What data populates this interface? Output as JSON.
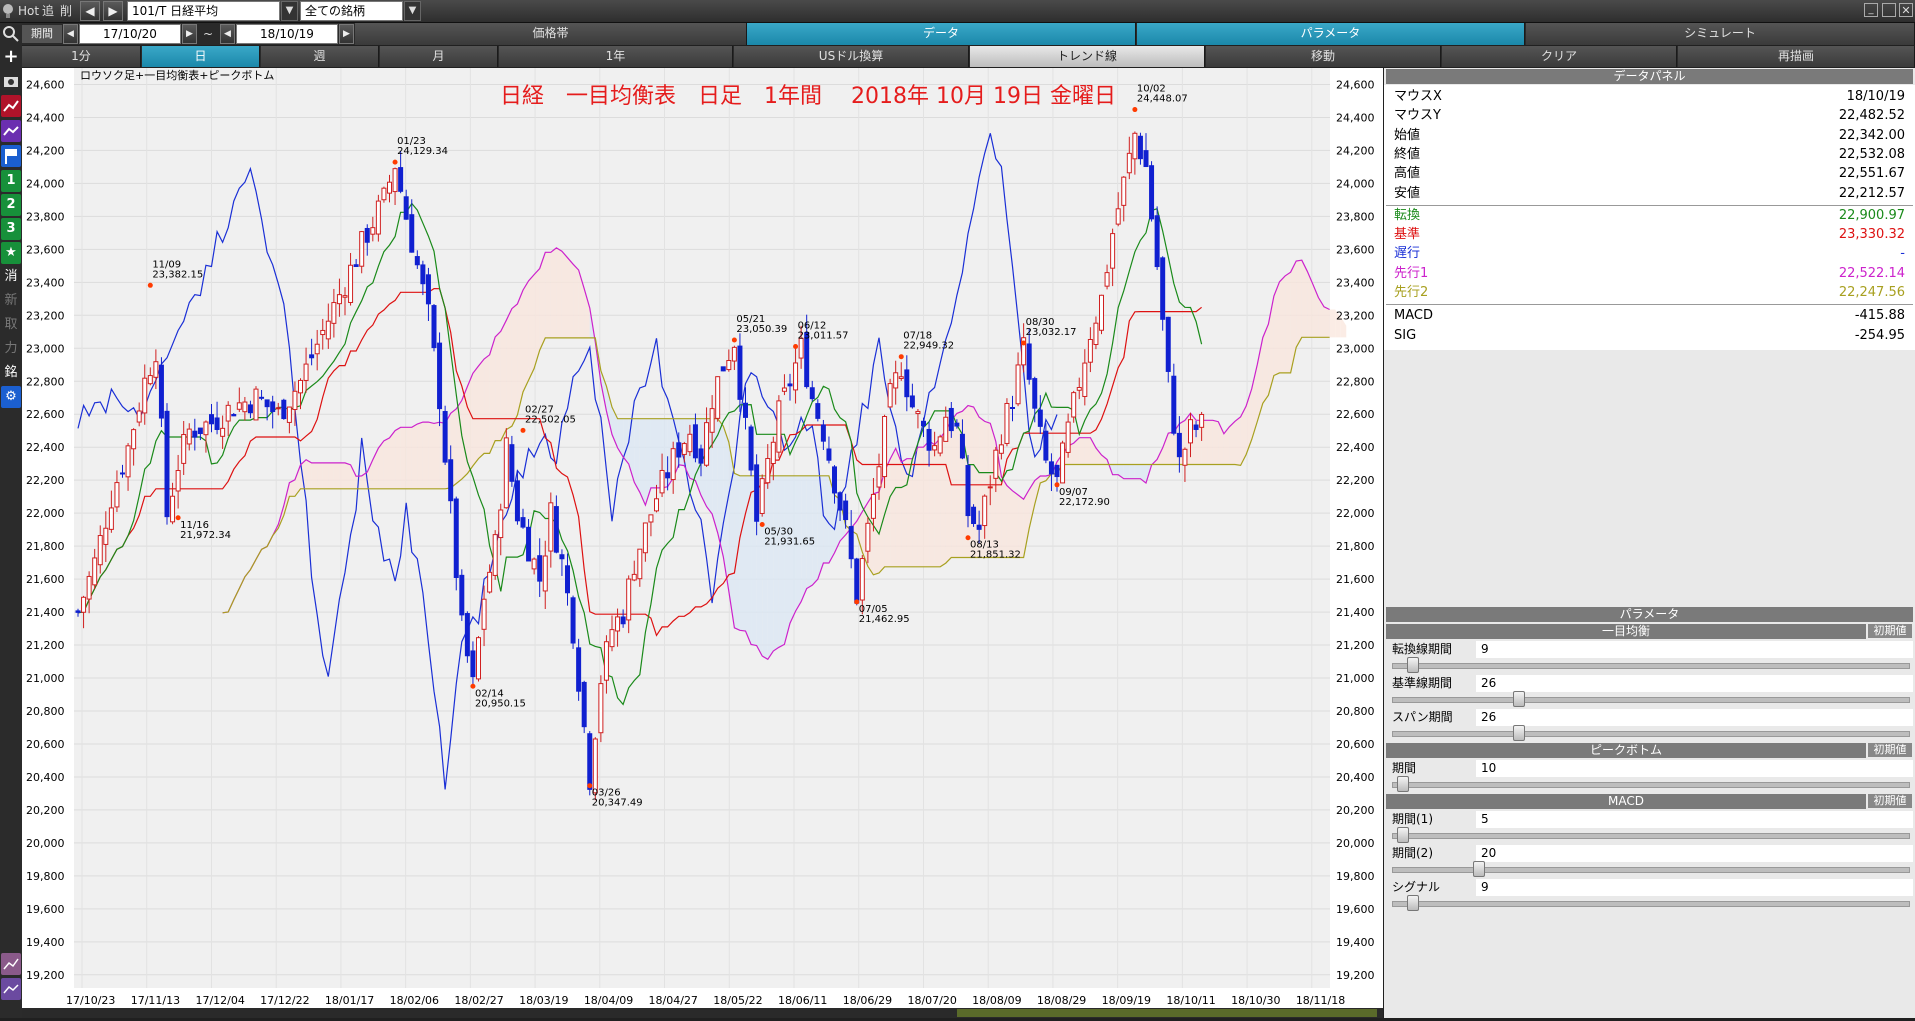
{
  "toolbar": {
    "hot": "Hot",
    "add": "追",
    "del": "削",
    "symbol": "101/T 日経平均",
    "universe": "全ての銘柄",
    "period_label": "期間",
    "date_from": "17/10/20",
    "dash": "~",
    "date_to": "18/10/19",
    "tabs_top": [
      "価格帯",
      "データ",
      "パラメータ",
      "シミュレート"
    ],
    "tabs_row": [
      "1分",
      "日",
      "週",
      "月",
      "1年",
      "USドル換算",
      "トレンド線",
      "移動",
      "クリア",
      "再描画"
    ]
  },
  "leftbar": {
    "items": [
      "1",
      "2",
      "3",
      "消",
      "新",
      "取",
      "力",
      "銘"
    ]
  },
  "chart": {
    "legend": "ロウソク足+一目均衡表+ピークボトム",
    "title": "日経　一目均衡表　日足　1年間　 2018年 10月 19日 金曜日",
    "y_ticks": [
      "24,600",
      "24,400",
      "24,200",
      "24,000",
      "23,800",
      "23,600",
      "23,400",
      "23,200",
      "23,000",
      "22,800",
      "22,600",
      "22,400",
      "22,200",
      "22,000",
      "21,800",
      "21,600",
      "21,400",
      "21,200",
      "21,000",
      "20,800",
      "20,600",
      "20,400",
      "20,200",
      "20,000",
      "19,800",
      "19,600",
      "19,400",
      "19,200"
    ],
    "x_ticks": [
      "17/10/23",
      "17/11/13",
      "17/12/04",
      "17/12/22",
      "18/01/17",
      "18/02/06",
      "18/02/27",
      "18/03/19",
      "18/04/09",
      "18/04/27",
      "18/05/22",
      "18/06/11",
      "18/06/29",
      "18/07/20",
      "18/08/09",
      "18/08/29",
      "18/09/19",
      "18/10/11",
      "18/10/30",
      "18/11/18"
    ],
    "peaks": [
      {
        "date": "11/09",
        "value": "23,382.15",
        "p": 23382
      },
      {
        "date": "11/16",
        "value": "21,972.34",
        "p": 21972
      },
      {
        "date": "01/23",
        "value": "24,129.34",
        "p": 24129
      },
      {
        "date": "02/14",
        "value": "20,950.15",
        "p": 20950
      },
      {
        "date": "02/27",
        "value": "22,502.05",
        "p": 22502
      },
      {
        "date": "03/26",
        "value": "20,347.49",
        "p": 20347
      },
      {
        "date": "05/21",
        "value": "23,050.39",
        "p": 23050
      },
      {
        "date": "05/30",
        "value": "21,931.65",
        "p": 21931
      },
      {
        "date": "06/12",
        "value": "23,011.57",
        "p": 23011
      },
      {
        "date": "07/05",
        "value": "21,462.95",
        "p": 21462
      },
      {
        "date": "07/18",
        "value": "22,949.32",
        "p": 22949
      },
      {
        "date": "08/13",
        "value": "21,851.32",
        "p": 21851
      },
      {
        "date": "08/30",
        "value": "23,032.17",
        "p": 23032
      },
      {
        "date": "09/07",
        "value": "22,172.90",
        "p": 22172
      },
      {
        "date": "10/02",
        "value": "24,448.07",
        "p": 24448
      }
    ]
  },
  "chart_data": {
    "type": "candlestick+ichimoku",
    "title": "日経　一目均衡表　日足　1年間　 2018年 10月 19日 金曜日",
    "ylim": [
      19200,
      24600
    ],
    "series": [
      {
        "name": "転換",
        "color": "#1a8a1a"
      },
      {
        "name": "基準",
        "color": "#dd1111"
      },
      {
        "name": "遅行",
        "color": "#1a2fd6"
      },
      {
        "name": "先行1",
        "color": "#cc22cc"
      },
      {
        "name": "先行2",
        "color": "#a8a020"
      }
    ],
    "close_path": [
      [
        0,
        21400
      ],
      [
        3,
        21700
      ],
      [
        6,
        22100
      ],
      [
        9,
        22400
      ],
      [
        12,
        22800
      ],
      [
        14,
        23000
      ],
      [
        16,
        21990
      ],
      [
        18,
        22300
      ],
      [
        20,
        22500
      ],
      [
        24,
        22550
      ],
      [
        28,
        22650
      ],
      [
        32,
        22700
      ],
      [
        36,
        22600
      ],
      [
        40,
        22800
      ],
      [
        44,
        23100
      ],
      [
        48,
        23400
      ],
      [
        52,
        23700
      ],
      [
        55,
        23900
      ],
      [
        57,
        24120
      ],
      [
        59,
        23800
      ],
      [
        61,
        23500
      ],
      [
        63,
        23200
      ],
      [
        65,
        22700
      ],
      [
        67,
        22000
      ],
      [
        69,
        21300
      ],
      [
        71,
        20950
      ],
      [
        73,
        21500
      ],
      [
        75,
        21800
      ],
      [
        77,
        22400
      ],
      [
        79,
        22000
      ],
      [
        81,
        21800
      ],
      [
        83,
        21600
      ],
      [
        85,
        22000
      ],
      [
        87,
        21700
      ],
      [
        89,
        21300
      ],
      [
        91,
        20700
      ],
      [
        92,
        20400
      ],
      [
        94,
        21000
      ],
      [
        96,
        21300
      ],
      [
        98,
        21400
      ],
      [
        100,
        21700
      ],
      [
        102,
        21900
      ],
      [
        104,
        22100
      ],
      [
        106,
        22250
      ],
      [
        108,
        22400
      ],
      [
        110,
        22500
      ],
      [
        112,
        22350
      ],
      [
        114,
        22700
      ],
      [
        116,
        22900
      ],
      [
        118,
        23050
      ],
      [
        120,
        22500
      ],
      [
        122,
        21950
      ],
      [
        124,
        22300
      ],
      [
        126,
        22600
      ],
      [
        128,
        22800
      ],
      [
        130,
        23000
      ],
      [
        132,
        22700
      ],
      [
        134,
        22500
      ],
      [
        136,
        22200
      ],
      [
        138,
        21900
      ],
      [
        140,
        21500
      ],
      [
        142,
        21900
      ],
      [
        144,
        22300
      ],
      [
        146,
        22700
      ],
      [
        148,
        22900
      ],
      [
        150,
        22650
      ],
      [
        152,
        22500
      ],
      [
        154,
        22400
      ],
      [
        156,
        22600
      ],
      [
        158,
        22500
      ],
      [
        160,
        22000
      ],
      [
        162,
        21900
      ],
      [
        164,
        22200
      ],
      [
        166,
        22500
      ],
      [
        168,
        22700
      ],
      [
        170,
        23000
      ],
      [
        172,
        22600
      ],
      [
        174,
        22300
      ],
      [
        176,
        22180
      ],
      [
        178,
        22500
      ],
      [
        180,
        22800
      ],
      [
        182,
        23100
      ],
      [
        184,
        23300
      ],
      [
        186,
        23700
      ],
      [
        188,
        24000
      ],
      [
        190,
        24300
      ],
      [
        192,
        24100
      ],
      [
        193,
        23800
      ],
      [
        194,
        23500
      ],
      [
        196,
        22800
      ],
      [
        198,
        22300
      ],
      [
        200,
        22500
      ],
      [
        202,
        22530
      ]
    ]
  },
  "panel": {
    "data_header": "データパネル",
    "rows": [
      {
        "k": "マウスX",
        "v": "18/10/19",
        "c": "#000"
      },
      {
        "k": "マウスY",
        "v": "22,482.52",
        "c": "#000"
      },
      {
        "k": "始値",
        "v": "22,342.00",
        "c": "#000"
      },
      {
        "k": "終値",
        "v": "22,532.08",
        "c": "#000"
      },
      {
        "k": "高値",
        "v": "22,551.67",
        "c": "#000"
      },
      {
        "k": "安値",
        "v": "22,212.57",
        "c": "#000"
      },
      {
        "k": "転換",
        "v": "22,900.97",
        "c": "#1a8a1a"
      },
      {
        "k": "基準",
        "v": "23,330.32",
        "c": "#dd1111"
      },
      {
        "k": "遅行",
        "v": "-",
        "c": "#1a2fd6"
      },
      {
        "k": "先行1",
        "v": "22,522.14",
        "c": "#cc22cc"
      },
      {
        "k": "先行2",
        "v": "22,247.56",
        "c": "#a8a020"
      },
      {
        "k": "MACD",
        "v": "-415.88",
        "c": "#000"
      },
      {
        "k": "SIG",
        "v": "-254.95",
        "c": "#000"
      }
    ],
    "param_header": "パラメータ",
    "reset": "初期値",
    "groups": [
      {
        "title": "一目均衡",
        "params": [
          {
            "label": "転換線期間",
            "value": "9",
            "pos": 0.03
          },
          {
            "label": "基準線期間",
            "value": "26",
            "pos": 0.24
          },
          {
            "label": "スパン期間",
            "value": "26",
            "pos": 0.24
          }
        ]
      },
      {
        "title": "ピークボトム",
        "params": [
          {
            "label": "期間",
            "value": "10",
            "pos": 0.01
          }
        ]
      },
      {
        "title": "MACD",
        "params": [
          {
            "label": "期間(1)",
            "value": "5",
            "pos": 0.01
          },
          {
            "label": "期間(2)",
            "value": "20",
            "pos": 0.16
          },
          {
            "label": "シグナル",
            "value": "9",
            "pos": 0.03
          }
        ]
      }
    ]
  }
}
